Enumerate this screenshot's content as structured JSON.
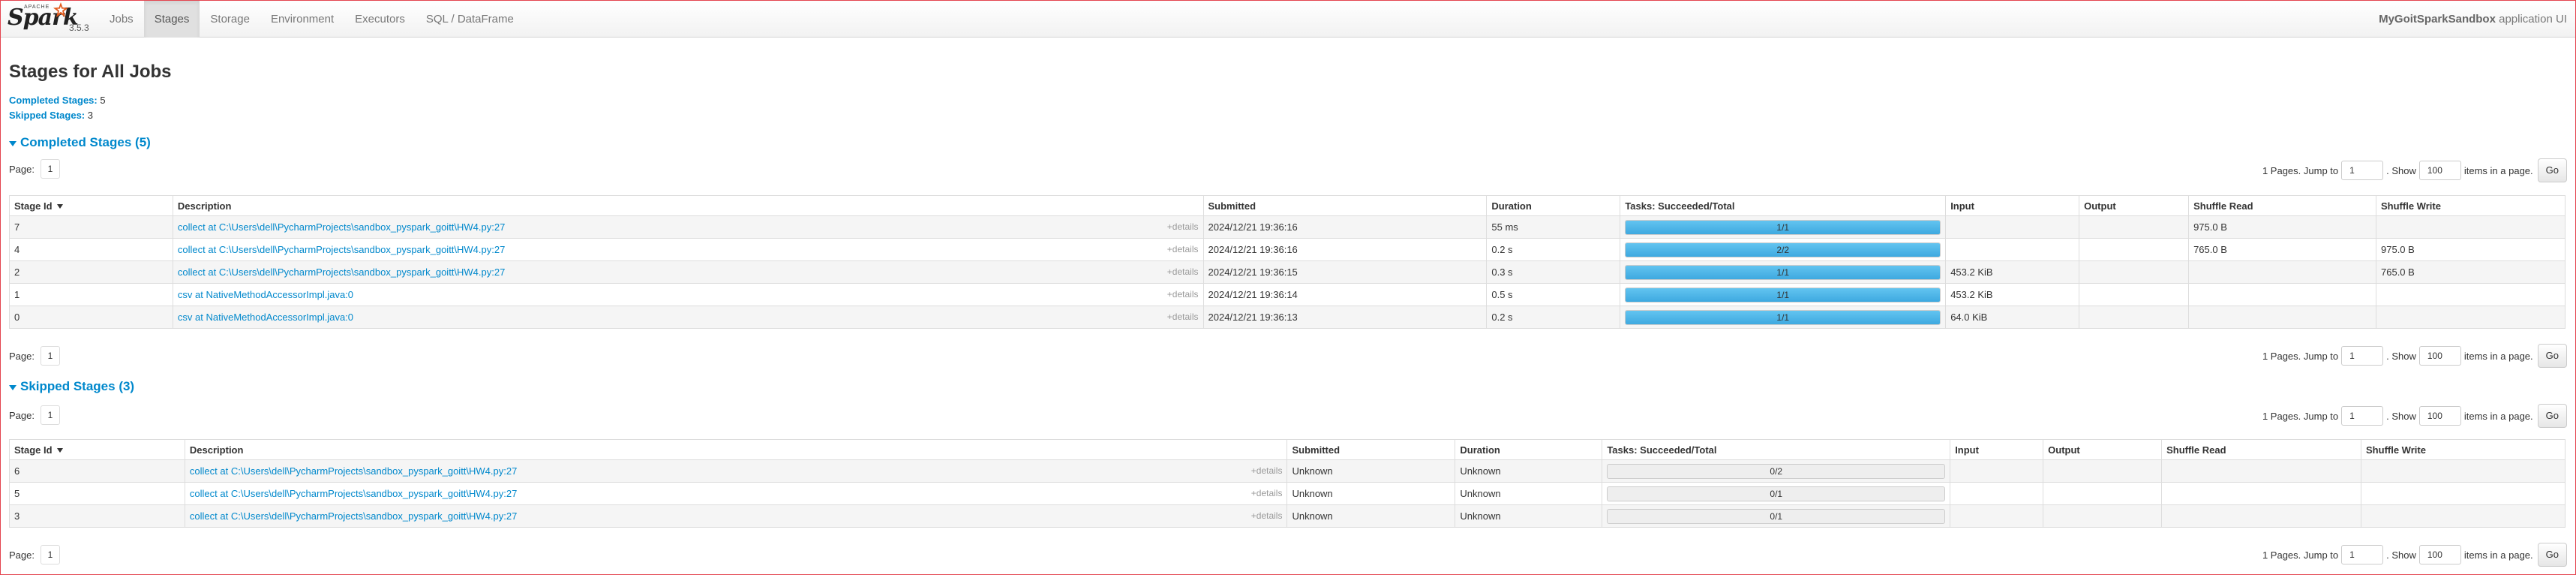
{
  "navbar": {
    "brand_apache": "APACHE",
    "brand_name": "Spark",
    "version": "3.5.3",
    "tabs": [
      "Jobs",
      "Stages",
      "Storage",
      "Environment",
      "Executors",
      "SQL / DataFrame"
    ],
    "active_tab": "Stages",
    "app_name": "MyGoitSparkSandbox",
    "app_suffix": "application UI"
  },
  "page": {
    "title": "Stages for All Jobs",
    "completed_label": "Completed Stages:",
    "completed_value": "5",
    "skipped_label": "Skipped Stages:",
    "skipped_value": "3"
  },
  "pager": {
    "page_label": "Page:",
    "page_value": "1",
    "pages_text": "1 Pages. Jump to",
    "jump_value": "1",
    "show_text": ". Show",
    "show_value": "100",
    "items_text": "items in a page.",
    "go_label": "Go"
  },
  "completed": {
    "title": "Completed Stages (5)",
    "headers": [
      "Stage Id",
      "Description",
      "Submitted",
      "Duration",
      "Tasks: Succeeded/Total",
      "Input",
      "Output",
      "Shuffle Read",
      "Shuffle Write"
    ],
    "rows": [
      {
        "id": "7",
        "desc": "collect at C:\\Users\\dell\\PycharmProjects\\sandbox_pyspark_goitt\\HW4.py:27",
        "details": "+details",
        "submitted": "2024/12/21 19:36:16",
        "duration": "55 ms",
        "tasks": "1/1",
        "progress": 1.0,
        "input": "",
        "output": "",
        "shuffle_read": "975.0 B",
        "shuffle_write": ""
      },
      {
        "id": "4",
        "desc": "collect at C:\\Users\\dell\\PycharmProjects\\sandbox_pyspark_goitt\\HW4.py:27",
        "details": "+details",
        "submitted": "2024/12/21 19:36:16",
        "duration": "0.2 s",
        "tasks": "2/2",
        "progress": 1.0,
        "input": "",
        "output": "",
        "shuffle_read": "765.0 B",
        "shuffle_write": "975.0 B"
      },
      {
        "id": "2",
        "desc": "collect at C:\\Users\\dell\\PycharmProjects\\sandbox_pyspark_goitt\\HW4.py:27",
        "details": "+details",
        "submitted": "2024/12/21 19:36:15",
        "duration": "0.3 s",
        "tasks": "1/1",
        "progress": 1.0,
        "input": "453.2 KiB",
        "output": "",
        "shuffle_read": "",
        "shuffle_write": "765.0 B"
      },
      {
        "id": "1",
        "desc": "csv at NativeMethodAccessorImpl.java:0",
        "details": "+details",
        "submitted": "2024/12/21 19:36:14",
        "duration": "0.5 s",
        "tasks": "1/1",
        "progress": 1.0,
        "input": "453.2 KiB",
        "output": "",
        "shuffle_read": "",
        "shuffle_write": ""
      },
      {
        "id": "0",
        "desc": "csv at NativeMethodAccessorImpl.java:0",
        "details": "+details",
        "submitted": "2024/12/21 19:36:13",
        "duration": "0.2 s",
        "tasks": "1/1",
        "progress": 1.0,
        "input": "64.0 KiB",
        "output": "",
        "shuffle_read": "",
        "shuffle_write": ""
      }
    ]
  },
  "skipped": {
    "title": "Skipped Stages (3)",
    "headers": [
      "Stage Id",
      "Description",
      "Submitted",
      "Duration",
      "Tasks: Succeeded/Total",
      "Input",
      "Output",
      "Shuffle Read",
      "Shuffle Write"
    ],
    "rows": [
      {
        "id": "6",
        "desc": "collect at C:\\Users\\dell\\PycharmProjects\\sandbox_pyspark_goitt\\HW4.py:27",
        "details": "+details",
        "submitted": "Unknown",
        "duration": "Unknown",
        "tasks": "0/2",
        "progress": 0.0,
        "input": "",
        "output": "",
        "shuffle_read": "",
        "shuffle_write": ""
      },
      {
        "id": "5",
        "desc": "collect at C:\\Users\\dell\\PycharmProjects\\sandbox_pyspark_goitt\\HW4.py:27",
        "details": "+details",
        "submitted": "Unknown",
        "duration": "Unknown",
        "tasks": "0/1",
        "progress": 0.0,
        "input": "",
        "output": "",
        "shuffle_read": "",
        "shuffle_write": ""
      },
      {
        "id": "3",
        "desc": "collect at C:\\Users\\dell\\PycharmProjects\\sandbox_pyspark_goitt\\HW4.py:27",
        "details": "+details",
        "submitted": "Unknown",
        "duration": "Unknown",
        "tasks": "0/1",
        "progress": 0.0,
        "input": "",
        "output": "",
        "shuffle_read": "",
        "shuffle_write": ""
      }
    ]
  },
  "colors": {
    "link": "#0088cc",
    "progress_fill": "#3ea9e0",
    "progress_track": "#eeeeee",
    "odd_row": "#f5f5f5",
    "frame_border": "#e4444f"
  }
}
